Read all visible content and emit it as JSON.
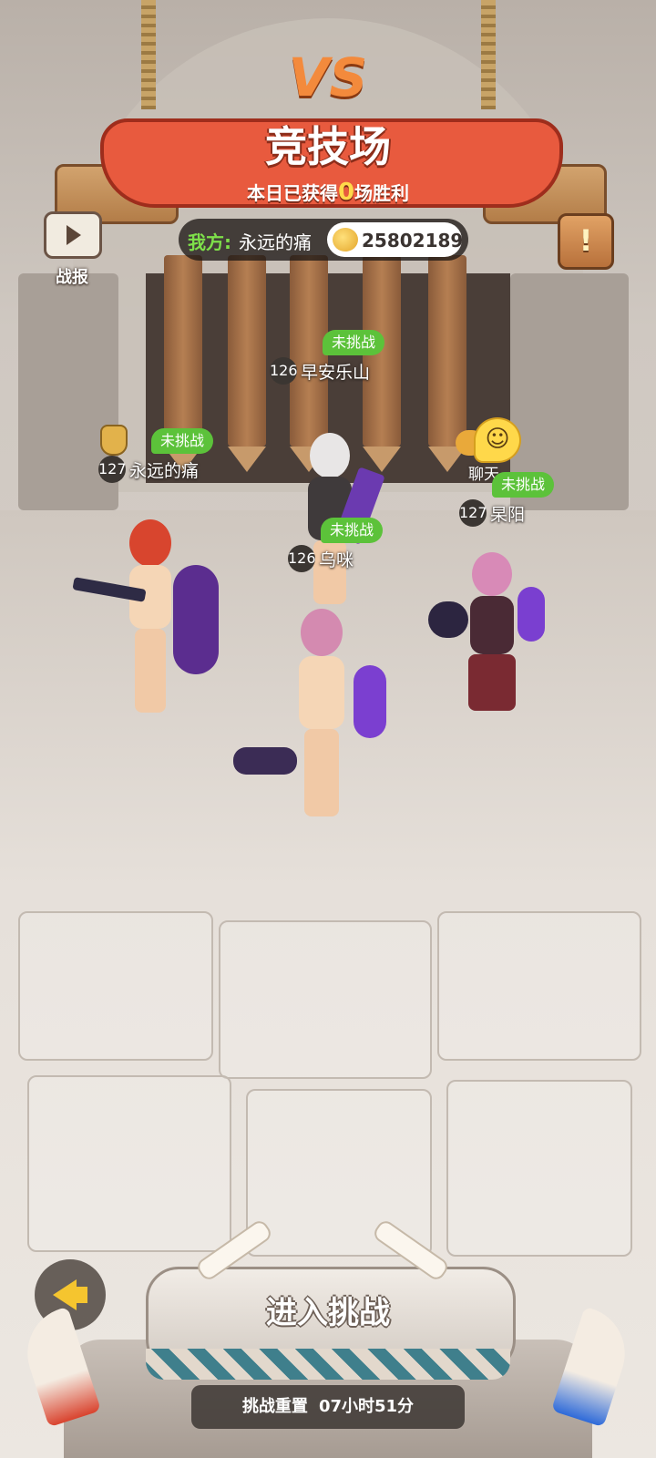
{
  "header": {
    "vs_label": "VS",
    "title": "竞技场",
    "subtitle_prefix": "本日已获得",
    "wins_today": "0",
    "subtitle_suffix": "场胜利"
  },
  "replay": {
    "label": "战报",
    "icon": "play-video-icon"
  },
  "player": {
    "side_label": "我方:",
    "name": "永远的痛",
    "coins": "25802189"
  },
  "rules_icon": "!",
  "opponents": [
    {
      "status": "未挑战",
      "level": "126",
      "name": "早安乐山"
    },
    {
      "status": "未挑战",
      "level": "127",
      "name": "永远的痛"
    },
    {
      "status": "未挑战",
      "level": "127",
      "name": "杲阳"
    },
    {
      "status": "未挑战",
      "level": "126",
      "name": "乌咪"
    }
  ],
  "chat": {
    "label": "聊天",
    "icon": "smiley-chat-icon"
  },
  "challenge": {
    "enter_label": "进入挑战",
    "reset_label": "挑战重置",
    "reset_time": "07小时51分"
  },
  "colors": {
    "status_green": "#5cc23a",
    "banner_red": "#e85a3e",
    "accent_yellow": "#ffd94a",
    "player_green": "#7ee04a"
  }
}
